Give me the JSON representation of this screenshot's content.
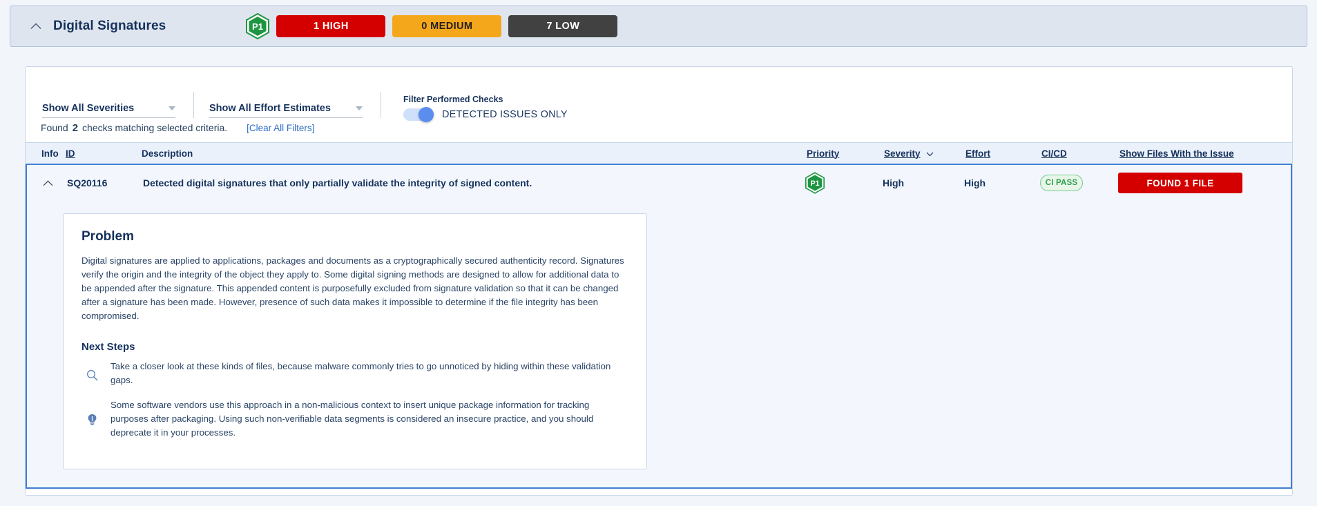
{
  "header": {
    "title": "Digital Signatures",
    "collapse_icon": "chevron-up-icon",
    "priority_badge": "P1",
    "badges": [
      {
        "label": "1 HIGH",
        "color": "#d40000"
      },
      {
        "label": "0 MEDIUM",
        "color": "#f5a71b"
      },
      {
        "label": "7 LOW",
        "color": "#414141"
      }
    ]
  },
  "filters": {
    "severity_select": "Show All Severities",
    "effort_select": "Show All Effort Estimates",
    "toggle_caption": "Filter Performed Checks",
    "toggle_label": "DETECTED ISSUES ONLY",
    "toggle_on": true
  },
  "results": {
    "found_prefix": "Found",
    "found_count": "2",
    "found_suffix": "checks matching selected criteria.",
    "clear_link": "[Clear All Filters]"
  },
  "table": {
    "columns": {
      "info": "Info",
      "id": "ID",
      "description": "Description",
      "priority": "Priority",
      "severity": "Severity",
      "effort": "Effort",
      "cicd": "CI/CD",
      "files": "Show Files With the Issue"
    },
    "row": {
      "collapse_icon": "chevron-up-icon",
      "id": "SQ20116",
      "description": "Detected digital signatures that only partially validate the integrity of signed content.",
      "priority": "P1",
      "severity": "High",
      "effort": "High",
      "cicd": "CI PASS",
      "files_button": "FOUND 1 FILE"
    }
  },
  "detail": {
    "problem_heading": "Problem",
    "problem_text": "Digital signatures are applied to applications, packages and documents as a cryptographically secured authenticity record. Signatures verify the origin and the integrity of the object they apply to. Some digital signing methods are designed to allow for additional data to be appended after the signature. This appended content is purposefully excluded from signature validation so that it can be changed after a signature has been made. However, presence of such data makes it impossible to determine if the file integrity has been compromised.",
    "next_steps_heading": "Next Steps",
    "steps": [
      {
        "icon": "magnifier-icon",
        "text": "Take a closer look at these kinds of files, because malware commonly tries to go unnoticed by hiding within these validation gaps."
      },
      {
        "icon": "lightbulb-icon",
        "text": "Some software vendors use this approach in a non-malicious context to insert unique package information for tracking purposes after packaging. Using such non-verifiable data segments is considered an insecure practice, and you should deprecate it in your processes."
      }
    ]
  },
  "colors": {
    "accent_blue": "#3f7fd0",
    "navy": "#16325c",
    "green": "#2e9e4f"
  }
}
